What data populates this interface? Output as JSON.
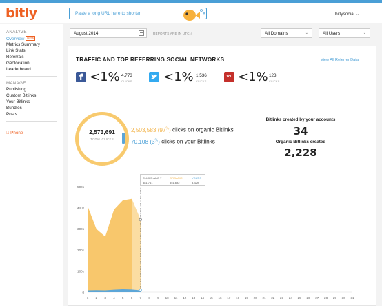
{
  "header": {
    "logo": "bitly",
    "shorten_placeholder": "Paste a long URL here to shorten",
    "account": "bitlysocial"
  },
  "sidebar": {
    "section_analyze": "ANALYZE",
    "analyze_items": [
      "Overview",
      "Metrics Summary",
      "Link Stats",
      "Referrals",
      "Geolocation",
      "Leaderboard"
    ],
    "new_badge": "NEW",
    "section_manage": "MANAGE",
    "manage_items": [
      "Publishing",
      "Custom Bitlinks",
      "Your Bitlinks",
      "Bundles",
      "Posts"
    ],
    "iphone": "iPhone"
  },
  "filters": {
    "date": "August 2014",
    "timezone_note": "REPORTS ARE IN UTC-4",
    "domains": "All Domains",
    "users": "All Users"
  },
  "card": {
    "title": "TRAFFIC AND TOP REFERRING SOCIAL NETWORKS",
    "view_all": "View All Referrer Data",
    "networks": [
      {
        "name": "facebook",
        "icon": "facebook-icon",
        "percent": "<1%",
        "clicks": "4,773",
        "label": "CLICKS",
        "color": "#3b5998"
      },
      {
        "name": "twitter",
        "icon": "twitter-icon",
        "percent": "<1%",
        "clicks": "1,536",
        "label": "CLICKS",
        "color": "#33aaf0"
      },
      {
        "name": "youtube",
        "icon": "youtube-icon",
        "percent": "<1%",
        "clicks": "123",
        "label": "CLICKS",
        "color": "#c4302b"
      }
    ],
    "total_clicks": "2,573,691",
    "total_label": "TOTAL CLICKS",
    "organic_value": "2,503,583 (97",
    "organic_pct_sup": "%",
    "organic_close": ")",
    "organic_text": " clicks on organic Bitlinks",
    "yours_value": "70,108 (3",
    "yours_pct_sup": "%",
    "yours_close": ")",
    "yours_text": " clicks on your Bitlinks",
    "created_by_accounts_label": "Bitlinks created by your accounts",
    "created_by_accounts_value": "34",
    "organic_created_label": "Organic Bitlinks created",
    "organic_created_value": "2,228"
  },
  "tooltip": {
    "date_label": "CLICKS AUG 7",
    "organic_label": "ORGANIC",
    "yours_label": "YOURS",
    "date_value": "581,761",
    "organic_value": "551,692",
    "yours_value": "8,329"
  },
  "colors": {
    "accent": "#ee6123",
    "link": "#4a9fd6",
    "organic": "#f8c76c",
    "yours": "#5ca6d8"
  },
  "chart_data": {
    "type": "area",
    "x": [
      1,
      2,
      3,
      4,
      5,
      6,
      7,
      8,
      9,
      10,
      11,
      12,
      13,
      14,
      15,
      16,
      17,
      18,
      19,
      20,
      21,
      22,
      23,
      24,
      25,
      26,
      27,
      28,
      29,
      30,
      31
    ],
    "yticks": [
      "0",
      "100k",
      "200k",
      "300k",
      "400k",
      "500k"
    ],
    "ylim": [
      0,
      500000
    ],
    "series": [
      {
        "name": "ORGANIC",
        "values": [
          400000,
          290000,
          255000,
          380000,
          422000,
          430000,
          335000
        ]
      },
      {
        "name": "YOURS",
        "values": [
          8000,
          9000,
          8000,
          11000,
          13000,
          12000,
          8329
        ]
      }
    ],
    "grid": false
  }
}
